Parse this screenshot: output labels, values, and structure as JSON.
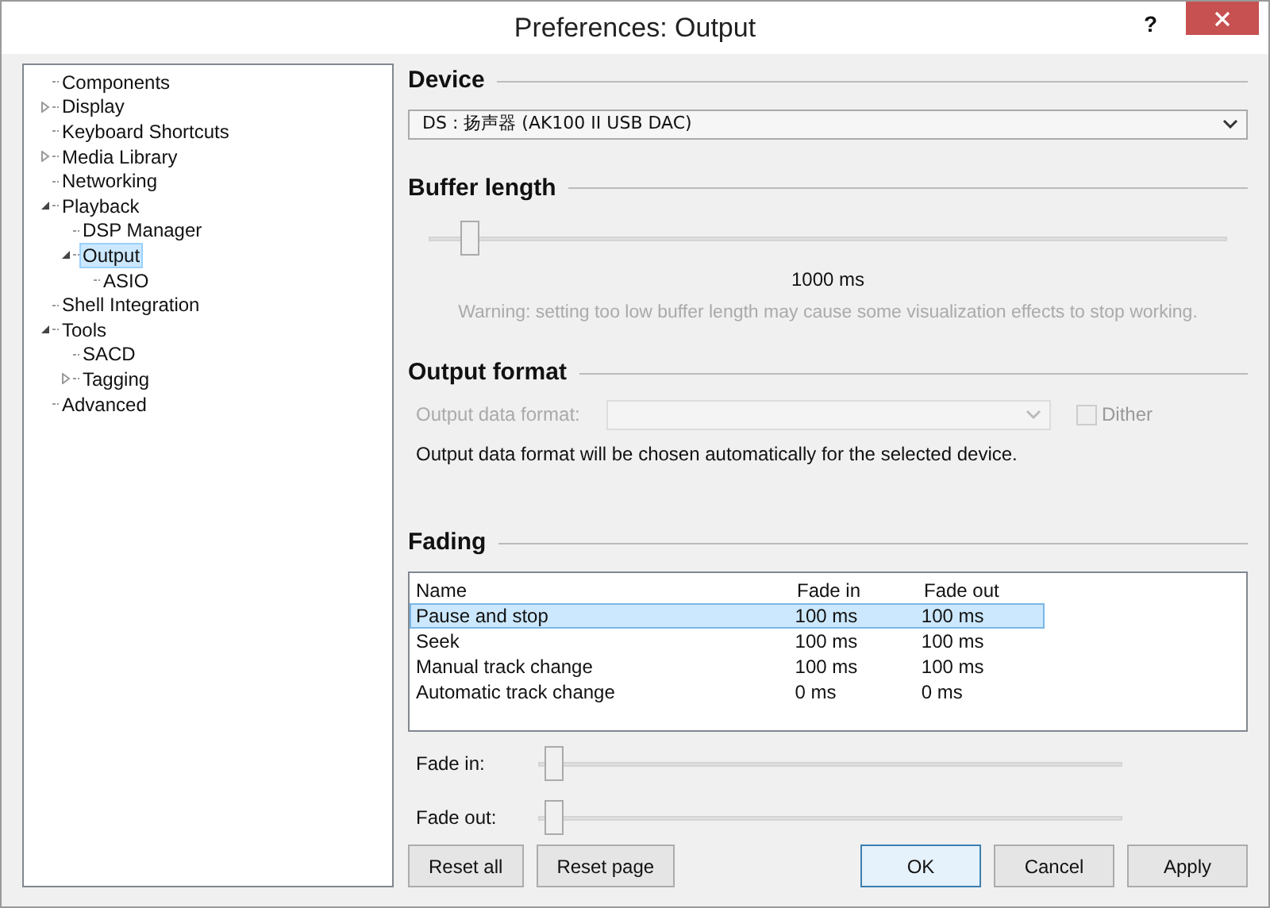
{
  "window": {
    "title": "Preferences: Output",
    "help": "?"
  },
  "tree": [
    {
      "label": "Components",
      "selected": false
    },
    {
      "label": "Display",
      "selected": false,
      "expanded": false
    },
    {
      "label": "Keyboard Shortcuts",
      "selected": false
    },
    {
      "label": "Media Library",
      "selected": false,
      "expanded": false
    },
    {
      "label": "Networking",
      "selected": false
    },
    {
      "label": "Playback",
      "selected": false,
      "expanded": true,
      "children": [
        {
          "label": "DSP Manager",
          "selected": false
        },
        {
          "label": "Output",
          "selected": true,
          "expanded": true,
          "children": [
            {
              "label": "ASIO",
              "selected": false
            }
          ]
        }
      ]
    },
    {
      "label": "Shell Integration",
      "selected": false
    },
    {
      "label": "Tools",
      "selected": false,
      "expanded": true,
      "children": [
        {
          "label": "SACD",
          "selected": false
        },
        {
          "label": "Tagging",
          "selected": false,
          "expanded": false
        }
      ]
    },
    {
      "label": "Advanced",
      "selected": false
    }
  ],
  "device": {
    "heading": "Device",
    "value": "DS : 扬声器 (AK100 II USB DAC)"
  },
  "buffer": {
    "heading": "Buffer length",
    "level": 0.04,
    "reading": "1000 ms",
    "warning": "Warning: setting too low buffer length may cause some visualization effects to stop working."
  },
  "output_format": {
    "heading": "Output format",
    "label": "Output data format:",
    "disabled": true,
    "dither": {
      "label": "Dither",
      "checked": false
    },
    "note": "Output data format will be chosen automatically for the selected device."
  },
  "fading": {
    "heading": "Fading",
    "columns": [
      "Name",
      "Fade in",
      "Fade out"
    ],
    "rows": [
      {
        "cells": [
          "Pause and stop",
          "100 ms",
          "100 ms"
        ],
        "selected": true
      },
      {
        "cells": [
          "Seek",
          "100 ms",
          "100 ms"
        ],
        "selected": false
      },
      {
        "cells": [
          "Manual track change",
          "100 ms",
          "100 ms"
        ],
        "selected": false
      },
      {
        "cells": [
          "Automatic track change",
          "0 ms",
          "0 ms"
        ],
        "selected": false
      }
    ],
    "sliders": [
      {
        "label": "Fade in:",
        "level": 0.01
      },
      {
        "label": "Fade out:",
        "level": 0.01
      }
    ]
  },
  "buttons_left": [
    "Reset all",
    "Reset page"
  ],
  "buttons_right": [
    {
      "label": "OK",
      "default": true
    },
    {
      "label": "Cancel",
      "default": false
    },
    {
      "label": "Apply",
      "default": false
    }
  ]
}
